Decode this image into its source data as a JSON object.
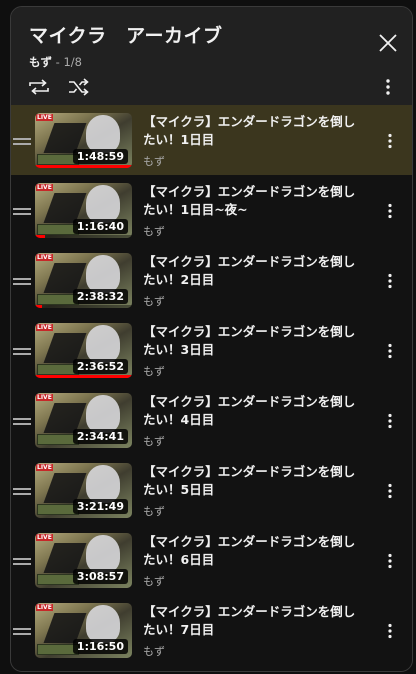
{
  "header": {
    "title": "マイクラ　アーカイブ",
    "owner": "もず",
    "position": " - 1/8"
  },
  "icons": {
    "close": "close-icon",
    "loop": "loop-icon",
    "shuffle": "shuffle-icon",
    "more": "more-vert-icon",
    "drag": "drag-handle-icon"
  },
  "colors": {
    "active_row": "#3b361e",
    "progress": "#ff0000",
    "panel": "#212121"
  },
  "items": [
    {
      "title": "【マイクラ】エンダードラゴンを倒したい！1日目",
      "owner": "もず",
      "duration": "1:48:59",
      "progress": 1.0,
      "active": true
    },
    {
      "title": "【マイクラ】エンダードラゴンを倒したい！1日目~夜~",
      "owner": "もず",
      "duration": "1:16:40",
      "progress": 0.1,
      "active": false
    },
    {
      "title": "【マイクラ】エンダードラゴンを倒したい！2日目",
      "owner": "もず",
      "duration": "2:38:32",
      "progress": 0.07,
      "active": false
    },
    {
      "title": "【マイクラ】エンダードラゴンを倒したい！3日目",
      "owner": "もず",
      "duration": "2:36:52",
      "progress": 1.0,
      "active": false
    },
    {
      "title": "【マイクラ】エンダードラゴンを倒したい！4日目",
      "owner": "もず",
      "duration": "2:34:41",
      "progress": 0,
      "active": false
    },
    {
      "title": "【マイクラ】エンダードラゴンを倒したい！5日目",
      "owner": "もず",
      "duration": "3:21:49",
      "progress": 0,
      "active": false
    },
    {
      "title": "【マイクラ】エンダードラゴンを倒したい！6日目",
      "owner": "もず",
      "duration": "3:08:57",
      "progress": 0,
      "active": false
    },
    {
      "title": "【マイクラ】エンダードラゴンを倒したい！7日目",
      "owner": "もず",
      "duration": "1:16:50",
      "progress": 0,
      "active": false
    }
  ]
}
